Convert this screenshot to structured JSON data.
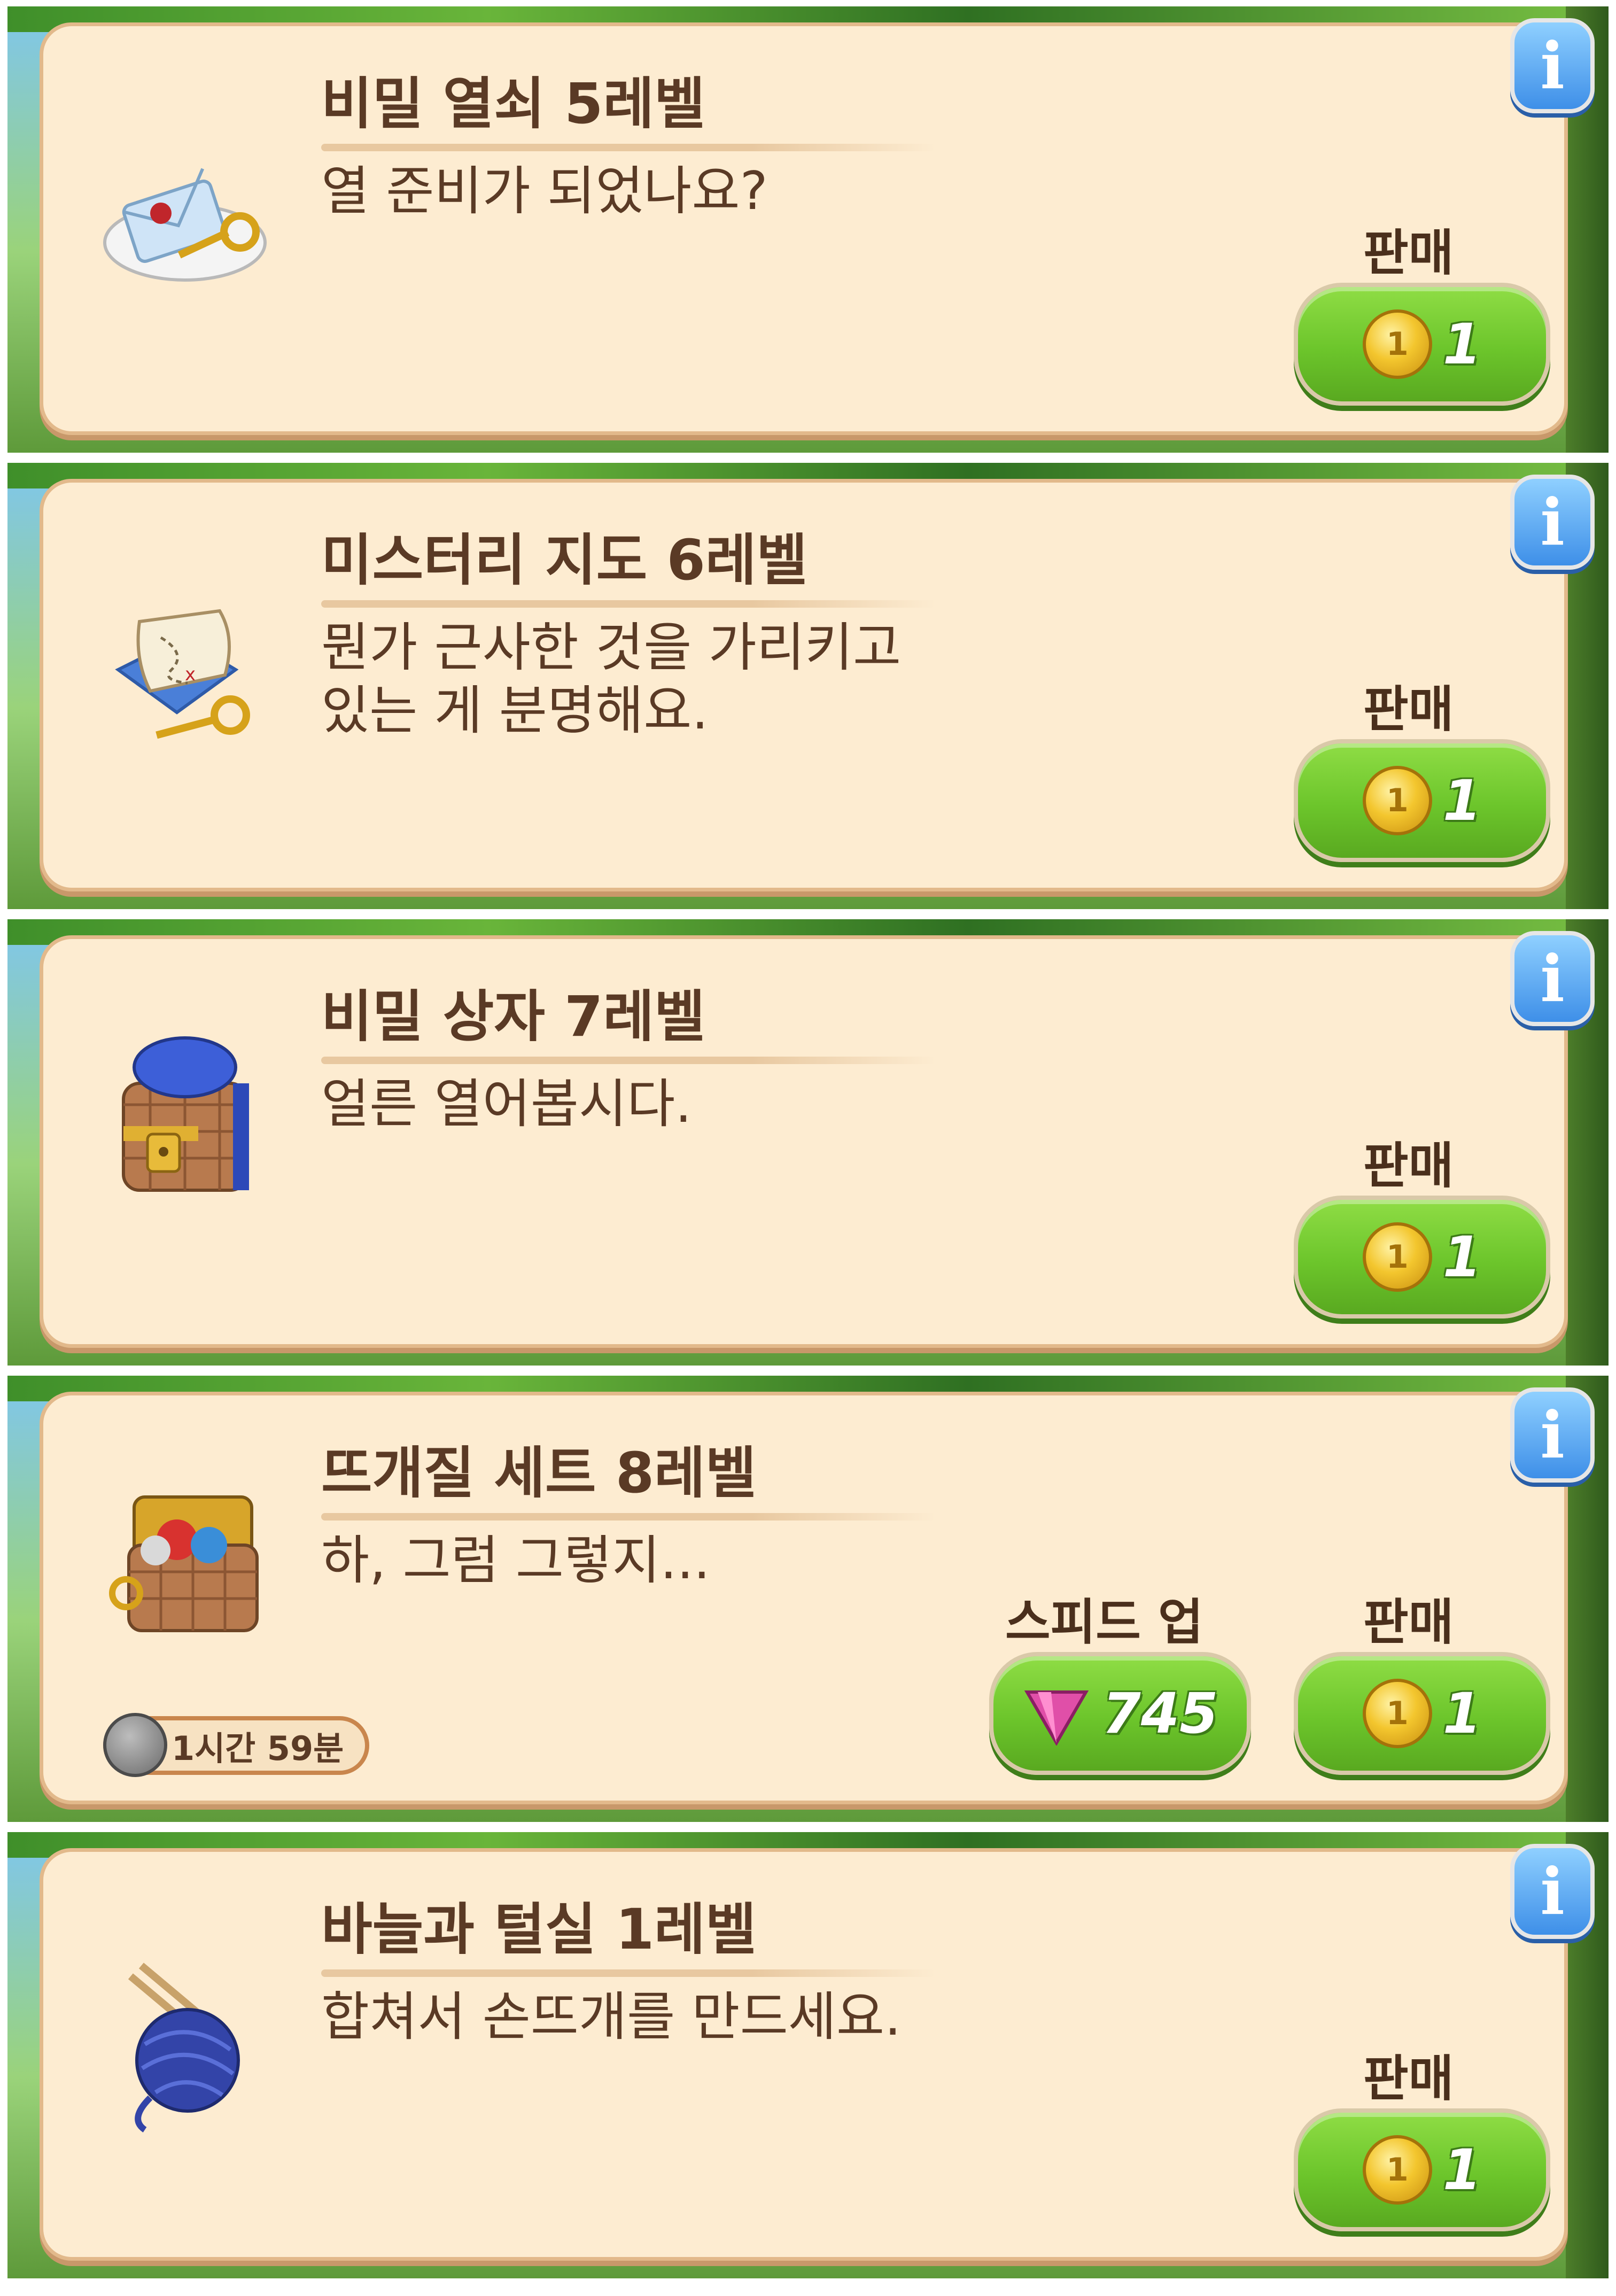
{
  "info_label": "i",
  "items": [
    {
      "title": "비밀 열쇠 5레벨",
      "description": "열 준비가 되었나요?",
      "sell_label": "판매",
      "sell_price": "1",
      "icon": "envelope-key-icon"
    },
    {
      "title": "미스터리 지도 6레벨",
      "description": "뭔가 근사한 것을 가리키고\n있는 게 분명해요.",
      "sell_label": "판매",
      "sell_price": "1",
      "icon": "treasure-map-key-icon"
    },
    {
      "title": "비밀 상자 7레벨",
      "description": "얼른 열어봅시다.",
      "sell_label": "판매",
      "sell_price": "1",
      "icon": "locked-gift-box-icon"
    },
    {
      "title": "뜨개질 세트 8레벨",
      "description": "하, 그럼 그렇지...",
      "sell_label": "판매",
      "sell_price": "1",
      "speedup_label": "스피드 업",
      "speedup_price": "745",
      "timer": "1시간 59분",
      "icon": "knitting-chest-icon"
    },
    {
      "title": "바늘과 털실 1레벨",
      "description": "합쳐서 손뜨개를 만드세요.",
      "sell_label": "판매",
      "sell_price": "1",
      "icon": "yarn-ball-needles-icon"
    }
  ],
  "colors": {
    "panel": "#fdecd1",
    "text": "#5a3a25",
    "button_green": "#6cc52b",
    "info_blue": "#3e8fe8",
    "gem_pink": "#e04fa8"
  }
}
